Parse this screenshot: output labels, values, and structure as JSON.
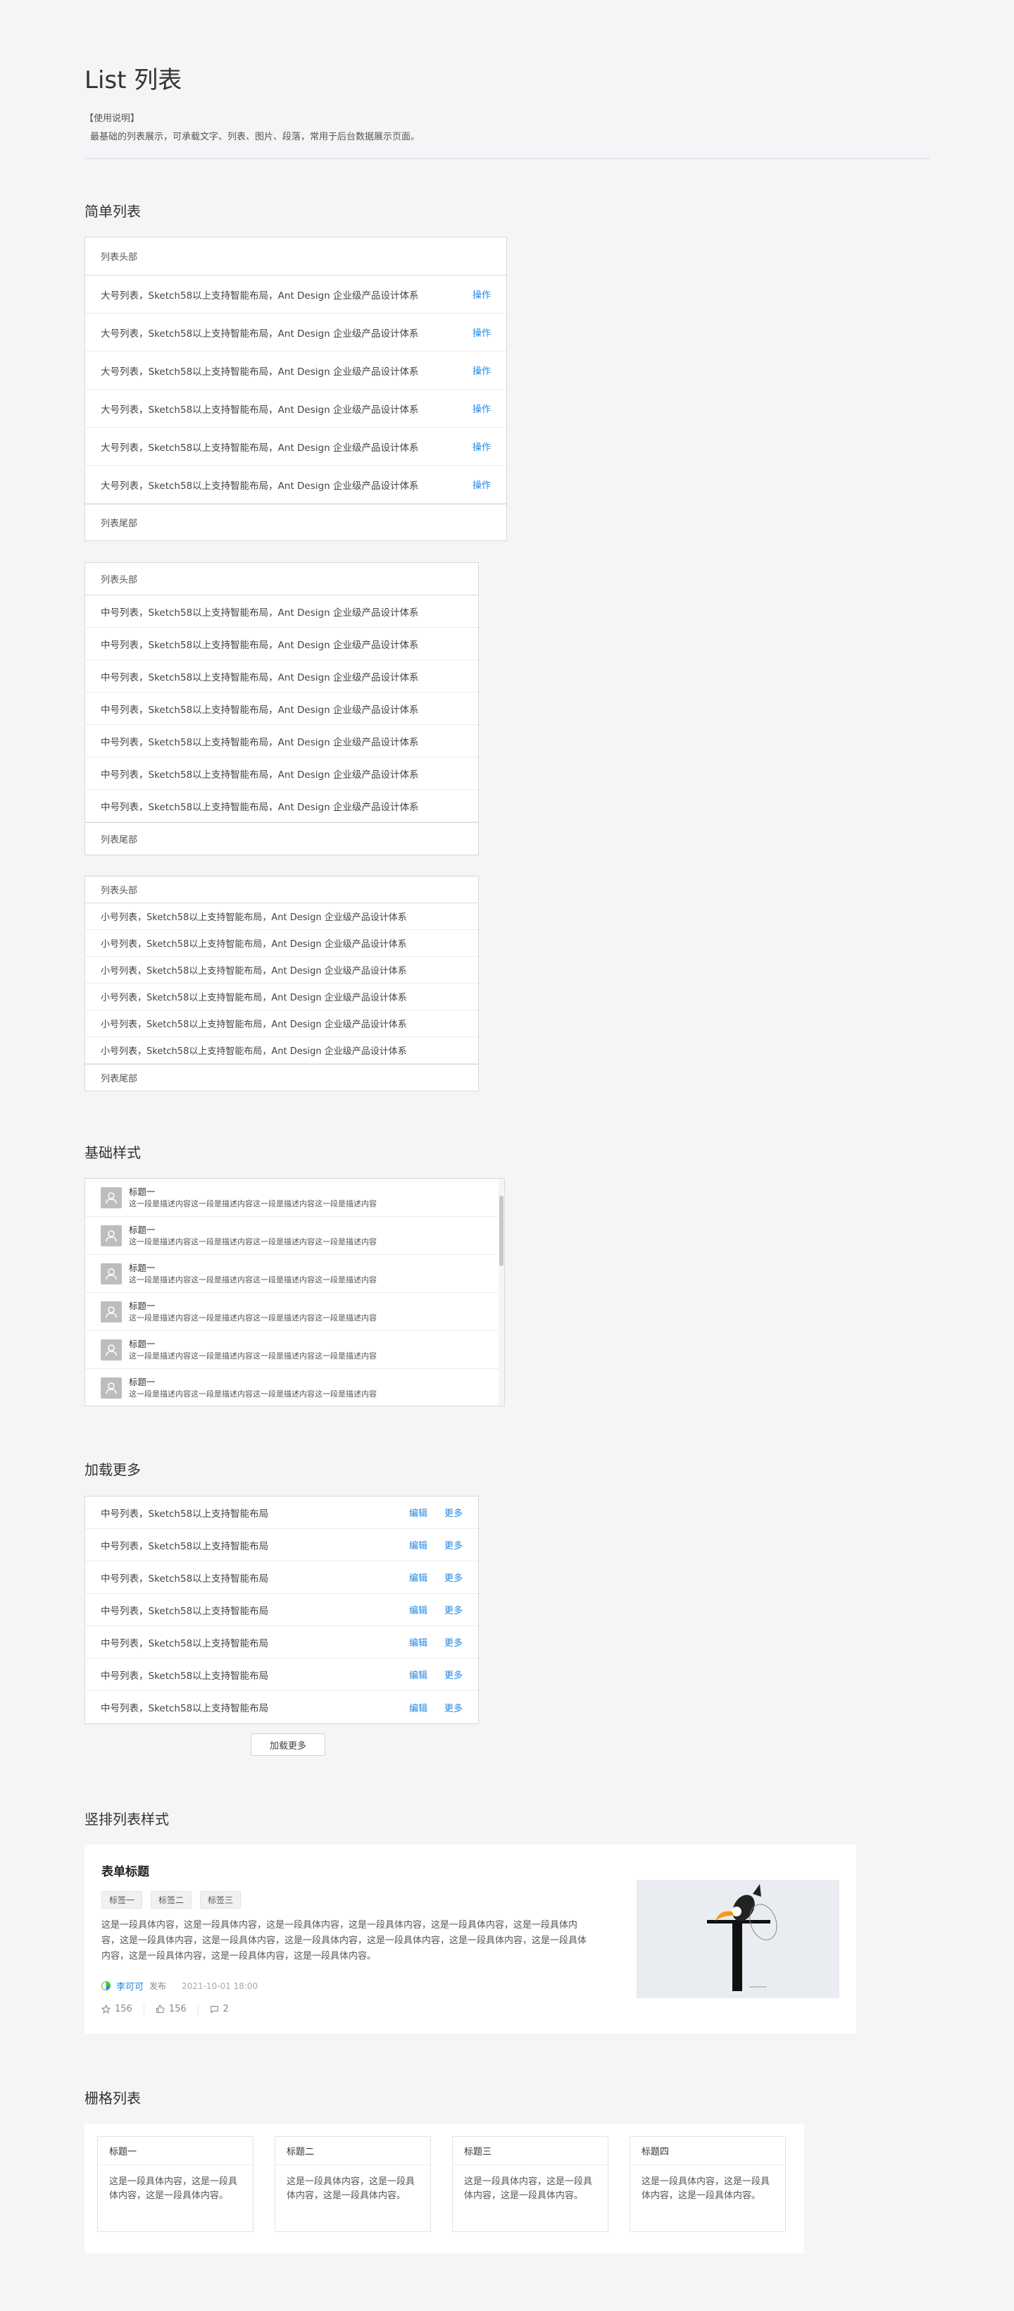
{
  "page": {
    "title": "List 列表",
    "note_head": "【使用说明】",
    "note_body": "最基础的列表展示，可承载文字、列表、图片、段落，常用于后台数据展示页面。"
  },
  "simple": {
    "title": "简单列表",
    "header": "列表头部",
    "footer": "列表尾部",
    "large_text": "大号列表，Sketch58以上支持智能布局，Ant Design 企业级产品设计体系",
    "large_action": "操作",
    "medium_text": "中号列表，Sketch58以上支持智能布局，Ant Design 企业级产品设计体系",
    "small_text": "小号列表，Sketch58以上支持智能布局，Ant Design 企业级产品设计体系"
  },
  "basic": {
    "title": "基础样式",
    "item_title": "标题一",
    "item_desc": "这一段是描述内容这一段是描述内容这一段是描述内容这一段是描述内容"
  },
  "loadmore": {
    "title": "加载更多",
    "row_text": "中号列表，Sketch58以上支持智能布局",
    "edit": "编辑",
    "more": "更多",
    "button": "加载更多"
  },
  "vertical": {
    "section_title": "竖排列表样式",
    "card_title": "表单标题",
    "tags": [
      "标签一",
      "标签二",
      "标签三"
    ],
    "paragraph": "这是一段具体内容，这是一段具体内容，这是一段具体内容，这是一段具体内容，这是一段具体内容，这是一段具体内容，这是一段具体内容，这是一段具体内容，这是一段具体内容，这是一段具体内容，这是一段具体内容，这是一段具体内容，这是一段具体内容，这是一段具体内容，这是一段具体内容。",
    "author": "李可可",
    "published": "发布",
    "date": "2021-10-01 18:00",
    "stars": "156",
    "likes": "156",
    "comments": "2"
  },
  "grid": {
    "title": "栅格列表",
    "cards": [
      {
        "title": "标题一",
        "body": "这是一段具体内容，这是一段具体内容，这是一段具体内容。"
      },
      {
        "title": "标题二",
        "body": "这是一段具体内容，这是一段具体内容，这是一段具体内容。"
      },
      {
        "title": "标题三",
        "body": "这是一段具体内容，这是一段具体内容，这是一段具体内容。"
      },
      {
        "title": "标题四",
        "body": "这是一段具体内容，这是一段具体内容，这是一段具体内容。"
      }
    ]
  },
  "colors": {
    "accent": "#1e88e5",
    "background": "#f4f5f7"
  }
}
